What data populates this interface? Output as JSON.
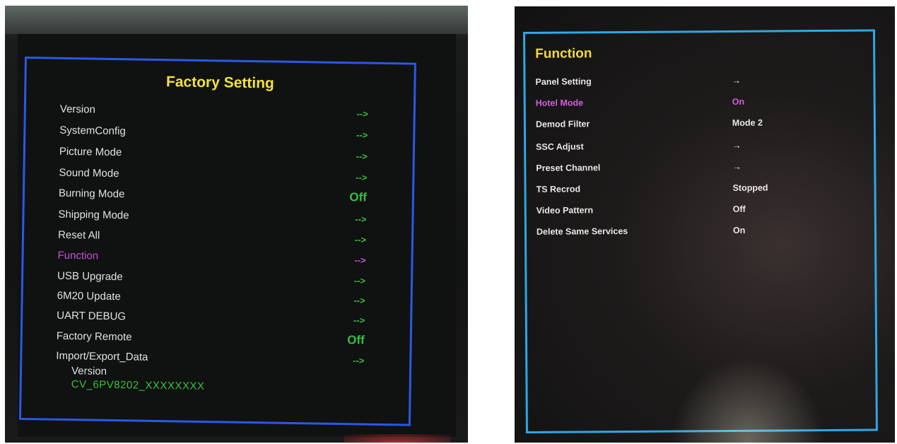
{
  "left_menu": {
    "title": "Factory Setting",
    "items": [
      {
        "label": "Version",
        "value": "-->"
      },
      {
        "label": "SystemConfig",
        "value": "-->"
      },
      {
        "label": "Picture Mode",
        "value": "-->"
      },
      {
        "label": "Sound Mode",
        "value": "-->"
      },
      {
        "label": "Burning Mode",
        "value": "Off"
      },
      {
        "label": "Shipping Mode",
        "value": "-->"
      },
      {
        "label": "Reset All",
        "value": "-->"
      },
      {
        "label": "Function",
        "value": "-->"
      },
      {
        "label": "USB Upgrade",
        "value": "-->"
      },
      {
        "label": "6M20 Update",
        "value": "-->"
      },
      {
        "label": "UART DEBUG",
        "value": "-->"
      },
      {
        "label": "Factory Remote",
        "value": "Off"
      },
      {
        "label": "Import/Export_Data",
        "value": "-->"
      }
    ],
    "selected_item": "Function",
    "version_label": "Version",
    "version_value": "CV_6PV8202_XXXXXXXX"
  },
  "right_menu": {
    "title": "Function",
    "items": [
      {
        "label": "Panel Setting",
        "value": "→"
      },
      {
        "label": "Hotel Mode",
        "value": "On"
      },
      {
        "label": "Demod Filter",
        "value": "Mode 2"
      },
      {
        "label": "SSC Adjust",
        "value": "→"
      },
      {
        "label": "Preset Channel",
        "value": "→"
      },
      {
        "label": "TS Recrod",
        "value": "Stopped"
      },
      {
        "label": "Video Pattern",
        "value": "Off"
      },
      {
        "label": "Delete Same Services",
        "value": "On"
      }
    ],
    "selected_item": "Hotel Mode"
  },
  "colors": {
    "title_yellow": "#f2e23a",
    "value_green": "#37c23a",
    "selected_purple": "#c455d8",
    "frame_left_blue": "#2b58e8",
    "frame_right_cyan": "#2ca8e6"
  }
}
